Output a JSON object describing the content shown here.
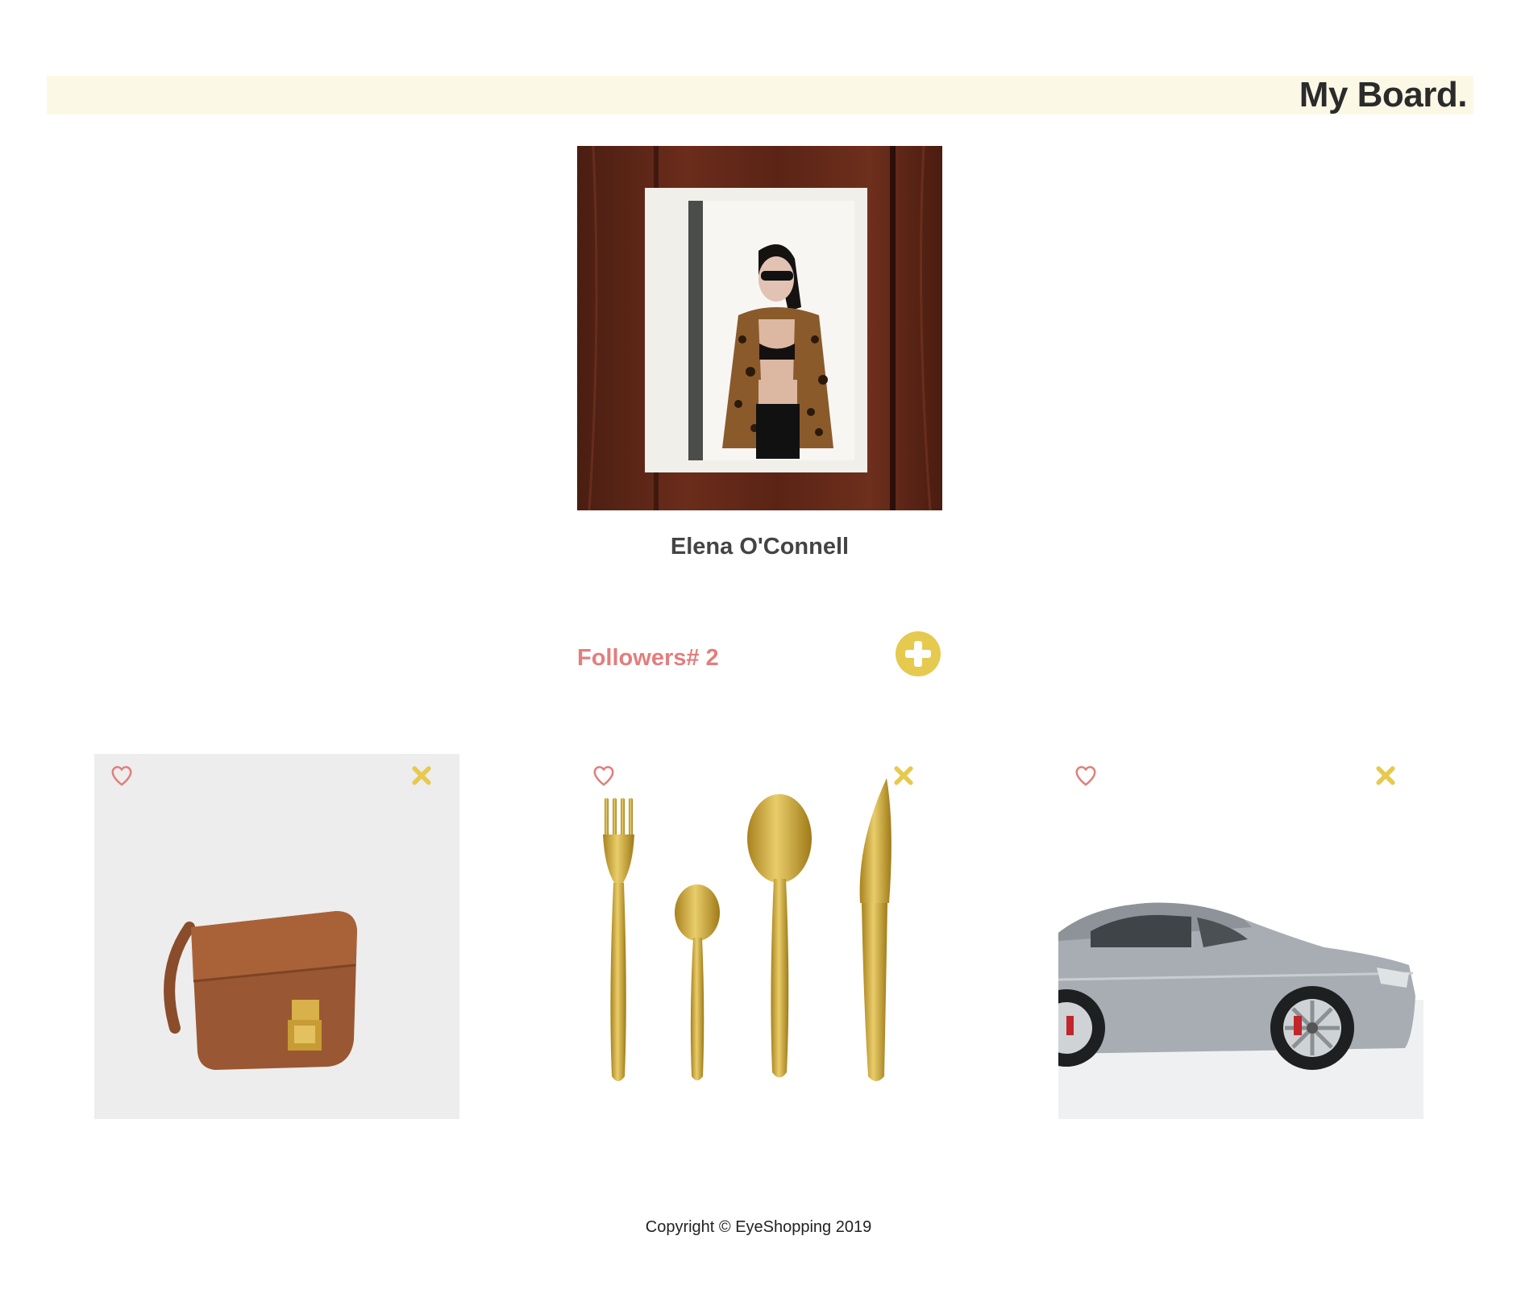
{
  "header": {
    "title": "My Board."
  },
  "profile": {
    "name": "Elena O'Connell",
    "followers_text": "Followers# 2",
    "followers_count": 2
  },
  "board": {
    "items": [
      {
        "name": "Brown leather handbag",
        "image_icon": "handbag-image"
      },
      {
        "name": "Gold cutlery set",
        "image_icon": "cutlery-image"
      },
      {
        "name": "Silver sports car",
        "image_icon": "car-image"
      }
    ],
    "like_icon": "heart-outline-icon",
    "remove_icon": "x-icon"
  },
  "footer": {
    "copyright": "Copyright © EyeShopping 2019"
  },
  "colors": {
    "header_bg": "#fbf8e6",
    "accent_pink": "#e17f7d",
    "accent_yellow": "#e6c94f"
  }
}
